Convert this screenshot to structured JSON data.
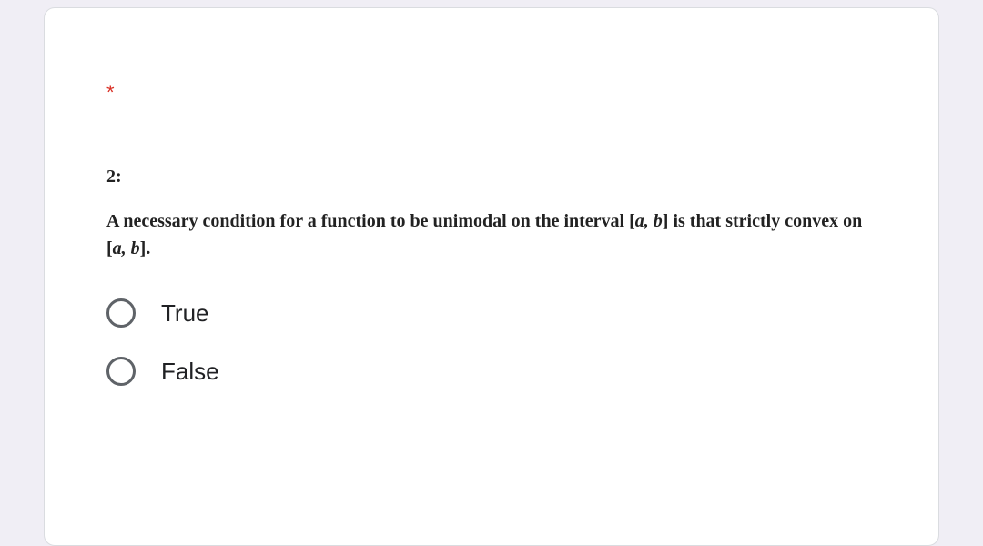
{
  "question": {
    "required_marker": "*",
    "number_label": "2:",
    "text_part1": "A necessary condition for a function to be unimodal on the interval ",
    "interval1_open": "[",
    "interval1_vars": "a, b",
    "interval1_close": "]",
    "text_part2": " is that strictly convex on ",
    "interval2_open": "[",
    "interval2_vars": "a, b",
    "interval2_close": "]",
    "text_part3": "."
  },
  "options": {
    "opt1": "True",
    "opt2": "False"
  }
}
